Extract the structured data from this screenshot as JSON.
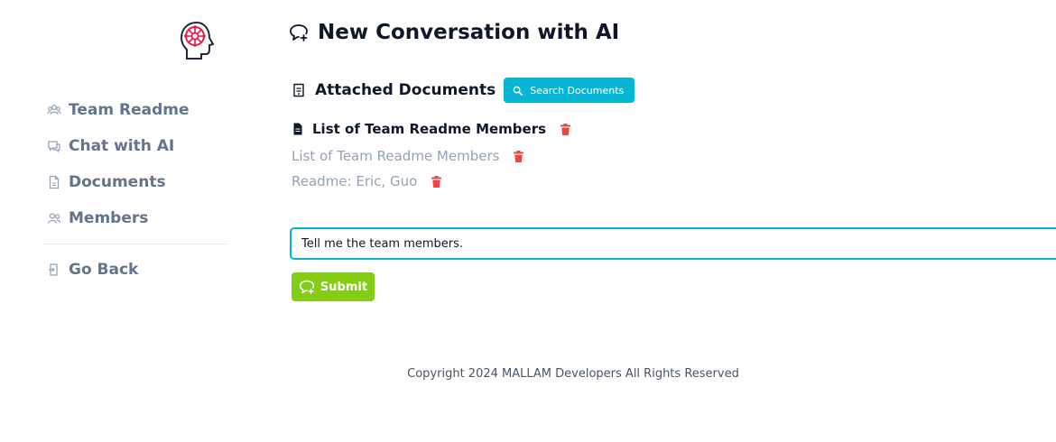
{
  "sidebar": {
    "logo_icon": "ai-brain-head-icon",
    "items": [
      {
        "label": "Team Readme",
        "icon": "team-icon"
      },
      {
        "label": "Chat with AI",
        "icon": "chat-icon"
      },
      {
        "label": "Documents",
        "icon": "document-icon"
      },
      {
        "label": "Members",
        "icon": "members-icon"
      }
    ],
    "go_back": {
      "label": "Go Back",
      "icon": "exit-icon"
    }
  },
  "main": {
    "title": "New Conversation with AI",
    "attached": {
      "title": "Attached Documents",
      "search_button": "Search Documents"
    },
    "documents": [
      {
        "name": "List of Team Readme Members",
        "style": "selected"
      },
      {
        "name": "List of Team Readme Members",
        "style": "muted"
      },
      {
        "name": "Readme: Eric, Guo",
        "style": "muted"
      }
    ],
    "prompt_value": "Tell me the team members.",
    "submit_label": "Submit"
  },
  "footer": "Copyright 2024 MALLAM Developers All Rights Reserved",
  "colors": {
    "accent_cyan": "#06b6d4",
    "submit_green": "#84cc16",
    "delete_red": "#ef4444",
    "logo_red": "#e11d48"
  }
}
